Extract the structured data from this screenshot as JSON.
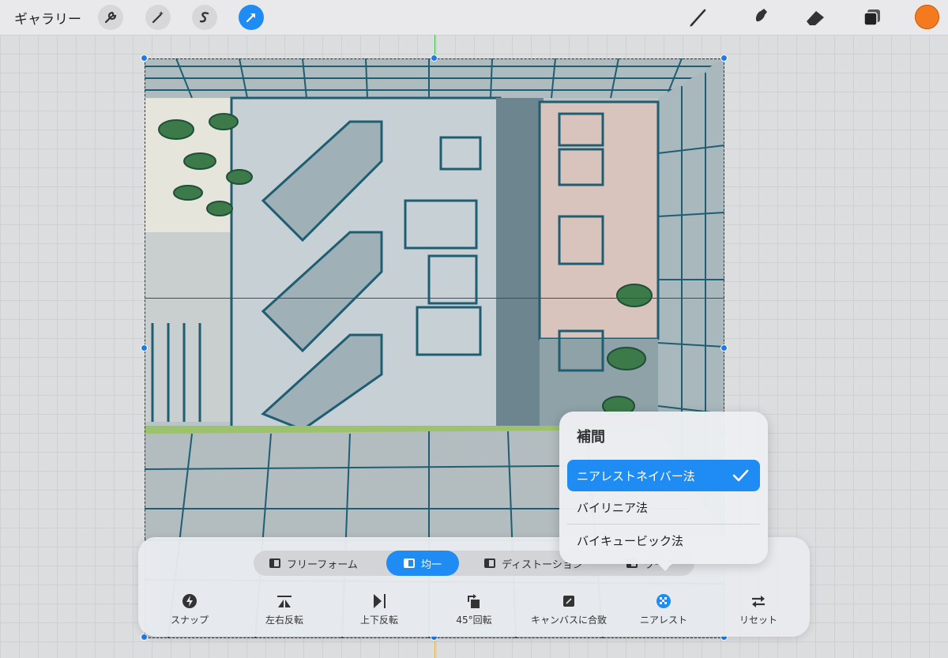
{
  "topbar": {
    "gallery_label": "ギャラリー",
    "left_tools": [
      {
        "name": "actions",
        "icon": "wrench-icon"
      },
      {
        "name": "adjustments",
        "icon": "magic-wand-icon"
      },
      {
        "name": "selection",
        "icon": "selection-s-icon"
      },
      {
        "name": "transform",
        "icon": "transform-arrow-icon",
        "active": true
      }
    ],
    "right_tools": [
      {
        "name": "brush",
        "icon": "brush-icon"
      },
      {
        "name": "smudge",
        "icon": "smudge-icon"
      },
      {
        "name": "eraser",
        "icon": "eraser-icon"
      },
      {
        "name": "layers",
        "icon": "layers-icon"
      }
    ],
    "current_color": "#f47a1f"
  },
  "transform_panel": {
    "modes": [
      {
        "label": "フリーフォーム",
        "active": false
      },
      {
        "label": "均一",
        "active": true
      },
      {
        "label": "ディストーション",
        "active": false
      },
      {
        "label": "ワープ",
        "active": false
      }
    ],
    "actions": [
      {
        "label": "スナップ",
        "icon": "snap-lightning-icon"
      },
      {
        "label": "左右反転",
        "icon": "flip-horizontal-icon"
      },
      {
        "label": "上下反転",
        "icon": "flip-vertical-icon"
      },
      {
        "label": "45°回転",
        "icon": "rotate-45-icon"
      },
      {
        "label": "キャンバスに合致",
        "icon": "fit-canvas-icon"
      },
      {
        "label": "ニアレスト",
        "icon": "interpolation-icon"
      },
      {
        "label": "リセット",
        "icon": "reset-icon"
      }
    ]
  },
  "interpolation_popover": {
    "title": "補間",
    "options": [
      {
        "label": "ニアレストネイバー法",
        "selected": true
      },
      {
        "label": "バイリニア法",
        "selected": false
      },
      {
        "label": "バイキュービック法",
        "selected": false
      }
    ]
  },
  "colors": {
    "accent": "#1f8cf3",
    "handle": "#1f7ae8",
    "guide_vertical": "#3fbf3f",
    "guide_horizontal": "#2740d8"
  }
}
